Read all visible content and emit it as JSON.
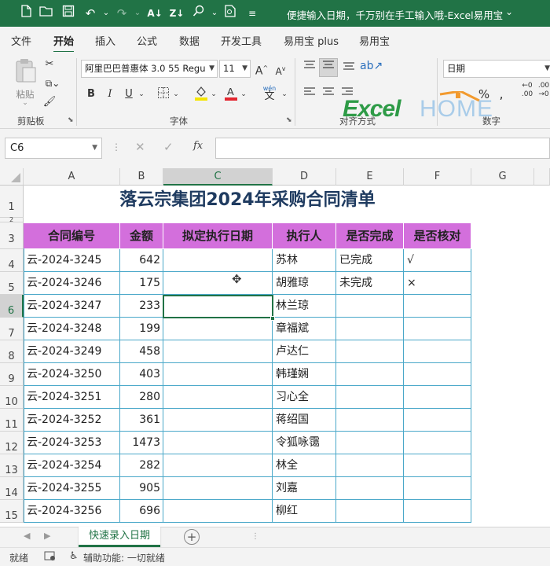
{
  "titlebar": {
    "doc_title": "便捷输入日期，千万别在手工输入哦-Excel易用宝..."
  },
  "ribbon_tabs": [
    "文件",
    "开始",
    "插入",
    "公式",
    "数据",
    "开发工具",
    "易用宝 plus",
    "易用宝"
  ],
  "ribbon": {
    "paste_label": "粘贴",
    "clipboard_label": "剪贴板",
    "font_name": "阿里巴巴普惠体 3.0 55 Regu",
    "font_size": "11",
    "font_group_label": "字体",
    "align_group_label": "对齐方式",
    "number_format": "日期",
    "number_group_label": "数字",
    "wen_label": "wén",
    "wen_char": "文",
    "accent_color": "#217346",
    "font_color_bar": "#e3262f",
    "fill_color_bar": "#f5e500"
  },
  "watermark": {
    "text_excel": "Excel",
    "text_home": "HOME"
  },
  "formula_bar": {
    "name_box": "C6",
    "fx_label": "fx",
    "value": ""
  },
  "columns": [
    "A",
    "B",
    "C",
    "D",
    "E",
    "F",
    "G"
  ],
  "selected_column": "C",
  "selected_row": "6",
  "sheet": {
    "title": "落云宗集团2024年采购合同清单",
    "headers": [
      "合同编号",
      "金额",
      "拟定执行日期",
      "执行人",
      "是否完成",
      "是否核对"
    ],
    "rows": [
      {
        "num": "4",
        "id": "云-2024-3245",
        "amount": "642",
        "date": "",
        "person": "苏林",
        "done": "已完成",
        "check": "√"
      },
      {
        "num": "5",
        "id": "云-2024-3246",
        "amount": "175",
        "date": "",
        "person": "胡雅琼",
        "done": "未完成",
        "check": "×"
      },
      {
        "num": "6",
        "id": "云-2024-3247",
        "amount": "233",
        "date": "",
        "person": "林兰琼",
        "done": "",
        "check": ""
      },
      {
        "num": "7",
        "id": "云-2024-3248",
        "amount": "199",
        "date": "",
        "person": "章福斌",
        "done": "",
        "check": ""
      },
      {
        "num": "8",
        "id": "云-2024-3249",
        "amount": "458",
        "date": "",
        "person": "卢达仁",
        "done": "",
        "check": ""
      },
      {
        "num": "9",
        "id": "云-2024-3250",
        "amount": "403",
        "date": "",
        "person": "韩瑾娴",
        "done": "",
        "check": ""
      },
      {
        "num": "10",
        "id": "云-2024-3251",
        "amount": "280",
        "date": "",
        "person": "习心全",
        "done": "",
        "check": ""
      },
      {
        "num": "11",
        "id": "云-2024-3252",
        "amount": "361",
        "date": "",
        "person": "蒋绍国",
        "done": "",
        "check": ""
      },
      {
        "num": "12",
        "id": "云-2024-3253",
        "amount": "1473",
        "date": "",
        "person": "令狐咏霭",
        "done": "",
        "check": ""
      },
      {
        "num": "13",
        "id": "云-2024-3254",
        "amount": "282",
        "date": "",
        "person": "林全",
        "done": "",
        "check": ""
      },
      {
        "num": "14",
        "id": "云-2024-3255",
        "amount": "905",
        "date": "",
        "person": "刘嘉",
        "done": "",
        "check": ""
      },
      {
        "num": "15",
        "id": "云-2024-3256",
        "amount": "696",
        "date": "",
        "person": "柳红",
        "done": "",
        "check": ""
      }
    ]
  },
  "sheet_tab": "快速录入日期",
  "status": {
    "ready": "就绪",
    "accessibility": "辅助功能: 一切就绪"
  }
}
